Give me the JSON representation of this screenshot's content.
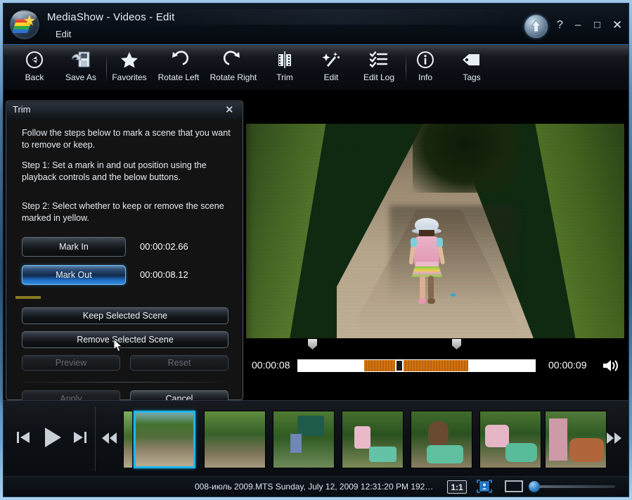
{
  "window": {
    "app_title": "MediaShow - Videos - Edit",
    "breadcrumb": "Edit",
    "logo_icon": "mediashow-orb-icon",
    "up_icon": "up-arrow-icon",
    "help_label": "?",
    "minimize_label": "–",
    "maximize_label": "□",
    "close_label": "✕"
  },
  "toolbar": {
    "items": [
      {
        "label": "Back",
        "icon": "back-arrow-icon"
      },
      {
        "label": "Save As",
        "icon": "save-as-icon"
      },
      {
        "label": "Favorites",
        "icon": "star-icon"
      },
      {
        "label": "Rotate Left",
        "icon": "rotate-left-icon"
      },
      {
        "label": "Rotate Right",
        "icon": "rotate-right-icon"
      },
      {
        "label": "Trim",
        "icon": "film-trim-icon"
      },
      {
        "label": "Edit",
        "icon": "magic-wand-icon"
      },
      {
        "label": "Edit Log",
        "icon": "checklist-icon"
      },
      {
        "label": "Info",
        "icon": "info-circle-icon"
      },
      {
        "label": "Tags",
        "icon": "tag-icon"
      }
    ]
  },
  "trim_dialog": {
    "title": "Trim",
    "close_icon": "close-icon",
    "intro": "Follow the steps below to mark a scene that you want to remove or keep.",
    "step1": "Step 1: Set a mark in and out position using the playback controls and the below buttons.",
    "step2": "Step 2: Select whether to keep or remove the scene marked in yellow.",
    "mark_in_label": "Mark In",
    "mark_in_time": "00:00:02.66",
    "mark_out_label": "Mark Out",
    "mark_out_time": "00:00:08.12",
    "keep_label": "Keep Selected Scene",
    "remove_label": "Remove Selected Scene",
    "preview_label": "Preview",
    "reset_label": "Reset",
    "apply_label": "Apply",
    "cancel_label": "Cancel",
    "cursor_icon": "mouse-pointer-icon",
    "highlight_color": "#2f8ae0",
    "selection_color": "#d4740f"
  },
  "player": {
    "time_current": "00:00:08",
    "time_total": "00:00:09",
    "volume_icon": "speaker-icon",
    "mark_in_icon": "mark-in-handle-icon",
    "mark_out_icon": "mark-out-handle-icon",
    "playhead_icon": "playhead-icon"
  },
  "filmstrip": {
    "prev_icon": "skip-previous-icon",
    "play_icon": "play-icon",
    "next_icon": "skip-next-icon",
    "rewind_icon": "rewind-icon",
    "forward_icon": "fast-forward-icon",
    "thumbs": [
      {
        "name": "thumb-path-selected",
        "selected": true
      },
      {
        "name": "thumb-woman-dog",
        "selected": false
      },
      {
        "name": "thumb-hat-basin",
        "selected": false
      },
      {
        "name": "thumb-pool-hose",
        "selected": false
      },
      {
        "name": "thumb-boy-arms-up",
        "selected": false
      },
      {
        "name": "thumb-filling-pool",
        "selected": false
      },
      {
        "name": "thumb-child-pool",
        "selected": false
      }
    ]
  },
  "status": {
    "file_info": "008-июль 2009.MTS  Sunday, July 12, 2009 12:31:20 PM  192…",
    "zoom_1to1_label": "1:1",
    "fit_icon": "fit-to-window-icon",
    "fullscreen_icon": "fullscreen-icon",
    "zoom_slider_icon": "zoom-slider-icon"
  }
}
